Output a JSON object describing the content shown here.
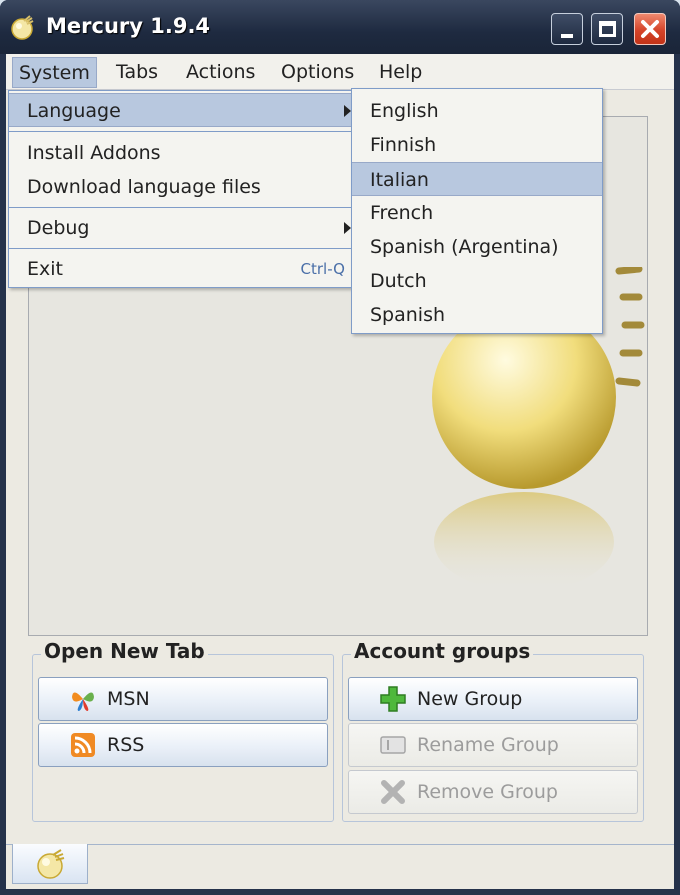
{
  "window": {
    "title": "Mercury 1.9.4"
  },
  "menubar": {
    "items": [
      "System",
      "Tabs",
      "Actions",
      "Options",
      "Help"
    ],
    "open": "System"
  },
  "system_menu": {
    "items": [
      {
        "label": "Language",
        "submenu": true
      },
      {
        "label": "Install Addons"
      },
      {
        "label": "Download language files"
      },
      {
        "label": "Debug",
        "submenu": true
      },
      {
        "label": "Exit",
        "shortcut": "Ctrl-Q"
      }
    ]
  },
  "language_menu": {
    "items": [
      "English",
      "Finnish",
      "Italian",
      "French",
      "Spanish (Argentina)",
      "Dutch",
      "Spanish"
    ],
    "highlighted": "Italian"
  },
  "open_new_tab": {
    "title": "Open New Tab",
    "buttons": [
      {
        "label": "MSN",
        "icon": "msn-butterfly-icon"
      },
      {
        "label": "RSS",
        "icon": "rss-icon"
      }
    ]
  },
  "account_groups": {
    "title": "Account groups",
    "buttons": [
      {
        "label": "New Group",
        "icon": "green-plus-icon",
        "enabled": true
      },
      {
        "label": "Rename Group",
        "icon": "rename-icon",
        "enabled": false
      },
      {
        "label": "Remove Group",
        "icon": "remove-x-icon",
        "enabled": false
      }
    ]
  },
  "colors": {
    "titlebar": "#1e2a40",
    "highlight": "#b8c8df",
    "close_button": "#d5442a",
    "menu_border": "#7f9cc8"
  }
}
